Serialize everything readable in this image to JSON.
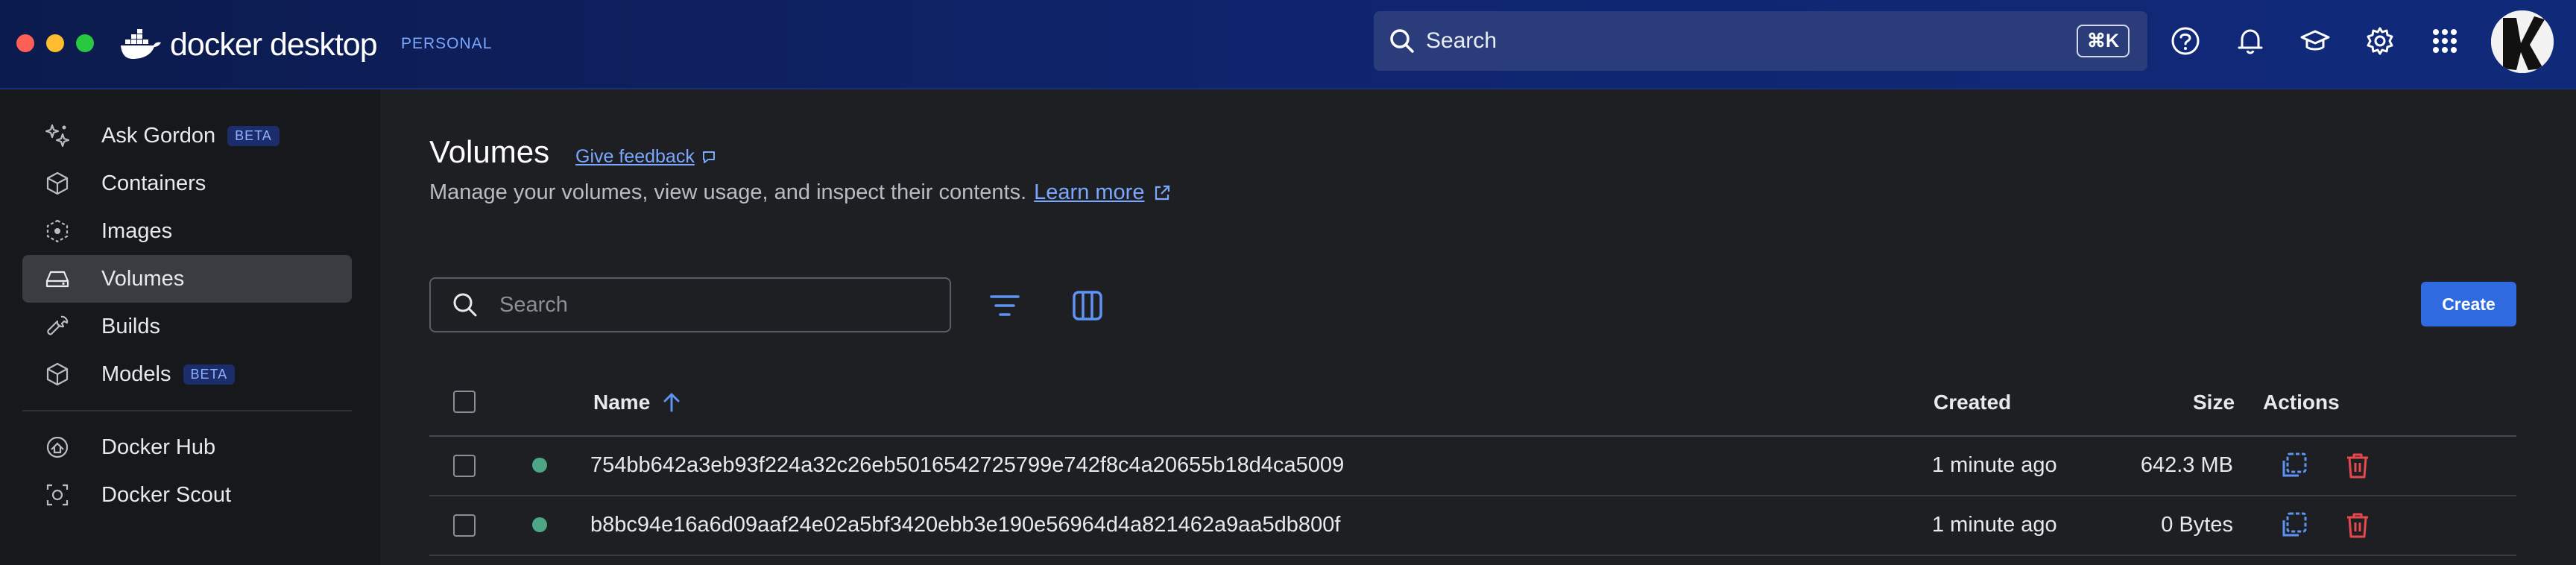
{
  "app": {
    "brand": "docker desktop",
    "tier": "PERSONAL"
  },
  "topbar": {
    "search_placeholder": "Search",
    "search_shortcut": "⌘K",
    "icons": [
      "help-icon",
      "bell-icon",
      "graduation-cap-icon",
      "gear-icon",
      "grid-icon"
    ]
  },
  "sidebar": {
    "items": [
      {
        "label": "Ask Gordon",
        "badge": "BETA",
        "icon": "sparkle-icon",
        "active": false
      },
      {
        "label": "Containers",
        "badge": "",
        "icon": "container-icon",
        "active": false
      },
      {
        "label": "Images",
        "badge": "",
        "icon": "image-icon",
        "active": false
      },
      {
        "label": "Volumes",
        "badge": "",
        "icon": "volume-icon",
        "active": true
      },
      {
        "label": "Builds",
        "badge": "",
        "icon": "wrench-icon",
        "active": false
      },
      {
        "label": "Models",
        "badge": "BETA",
        "icon": "cube-icon",
        "active": false
      }
    ],
    "items2": [
      {
        "label": "Docker Hub",
        "icon": "hub-icon"
      },
      {
        "label": "Docker Scout",
        "icon": "scout-icon"
      }
    ]
  },
  "main": {
    "title": "Volumes",
    "feedback": "Give feedback",
    "subtitle": "Manage your volumes, view usage, and inspect their contents.",
    "learn_more": "Learn more",
    "search_placeholder": "Search",
    "create_label": "Create",
    "columns": {
      "name": "Name",
      "created": "Created",
      "size": "Size",
      "actions": "Actions"
    },
    "rows": [
      {
        "name": "754bb642a3eb93f224a32c26eb5016542725799e742f8c4a20655b18d4ca5009",
        "created": "1 minute ago",
        "size": "642.3 MB",
        "status": "in-use"
      },
      {
        "name": "b8bc94e16a6d09aaf24e02a5bf3420ebb3e190e56964d4a821462a9aa5db800f",
        "created": "1 minute ago",
        "size": "0 Bytes",
        "status": "in-use"
      }
    ]
  },
  "colors": {
    "accent": "#2f6ae0",
    "link": "#7aa7ff",
    "status_green": "#4fa686",
    "delete_red": "#e5484d"
  }
}
